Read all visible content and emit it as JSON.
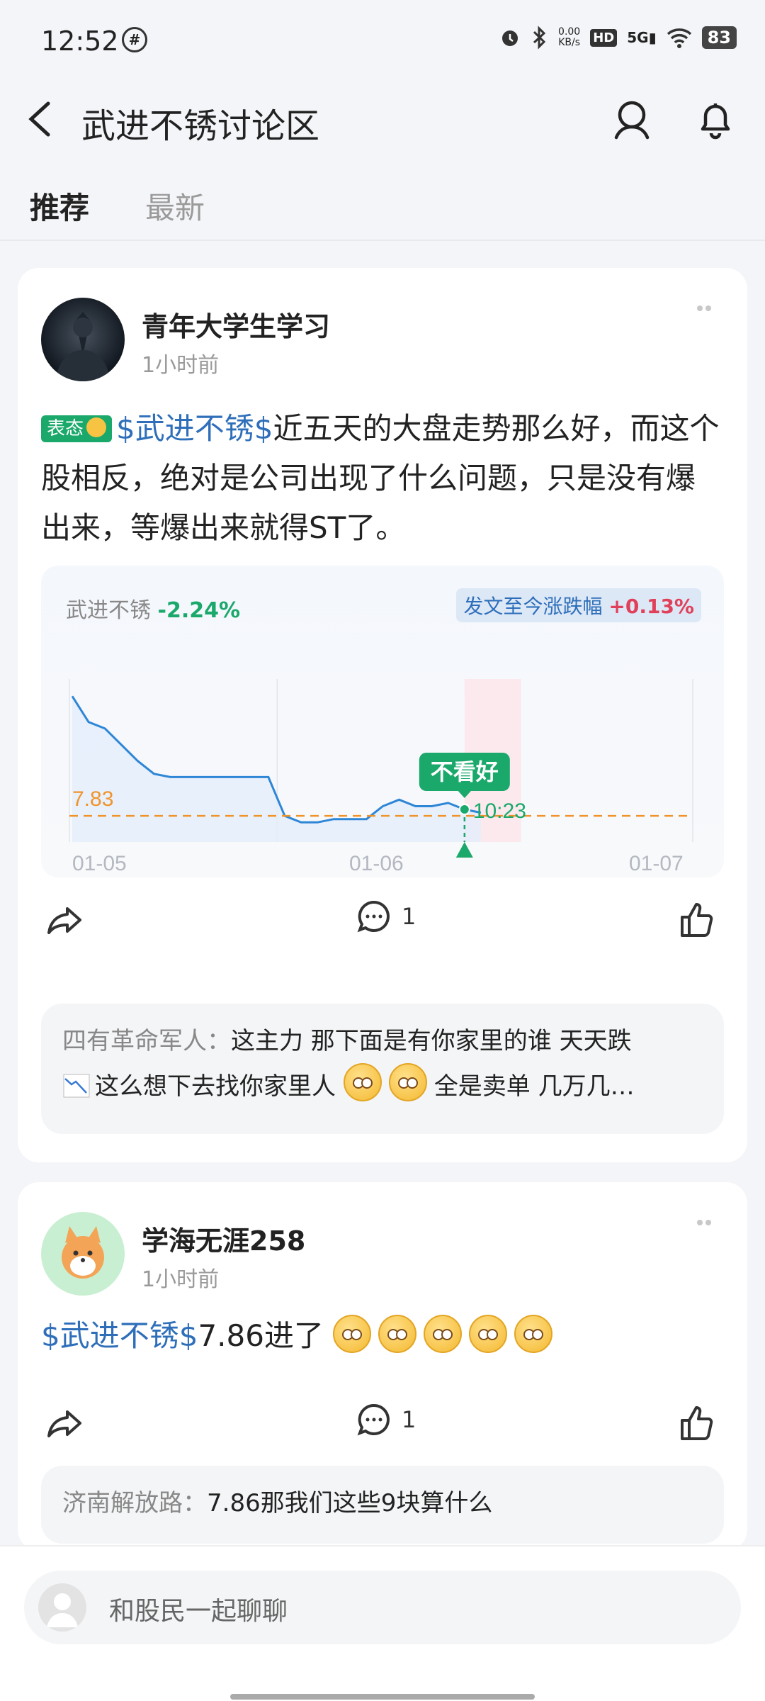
{
  "status_bar": {
    "time": "12:52",
    "network_speed_value": "0.00",
    "network_speed_unit": "KB/s",
    "hd_label": "HD",
    "signal_label": "5G",
    "battery": "83"
  },
  "header": {
    "title": "武进不锈讨论区"
  },
  "tabs": [
    {
      "label": "推荐",
      "active": true
    },
    {
      "label": "最新",
      "active": false
    }
  ],
  "posts": [
    {
      "author": "青年大学生学习",
      "time": "1小时前",
      "mood": "表态",
      "stock_tag": "$武进不锈$",
      "text_rest": "近五天的大盘走势那么好，而这个股相反，绝对是公司出现了什么问题，只是没有爆出来，等爆出来就得ST了。",
      "comment_count": "1",
      "comment_preview": {
        "author": "四有革命军人：",
        "text_part1": "这主力 那下面是有你家里的谁 天天跌",
        "text_part2": "这么想下去找你家里人",
        "text_part3": "全是卖单 几万几…"
      }
    },
    {
      "author": "学海无涯258",
      "time": "1小时前",
      "stock_tag": "$武进不锈$",
      "text_rest": "7.86进了",
      "comment_count": "1",
      "comment_preview": {
        "author": "济南解放路：",
        "text": "7.86那我们这些9块算什么"
      }
    }
  ],
  "chart_data": {
    "type": "line",
    "stock_name": "武进不锈",
    "change": "-2.24%",
    "since_post_label": "发文至今涨跌幅",
    "since_post_value": "+0.13%",
    "x_ticks": [
      "01-05",
      "01-06",
      "01-07"
    ],
    "reference_price_label": "7.83",
    "marker_label": "不看好",
    "marker_value_label": "10:23",
    "series": [
      {
        "values": [
          8.2,
          8.12,
          8.1,
          8.05,
          8.0,
          7.96,
          7.95,
          7.95,
          7.95,
          7.95,
          7.95,
          7.95,
          7.95,
          7.83,
          7.81,
          7.81,
          7.82,
          7.82,
          7.82,
          7.86,
          7.88,
          7.86,
          7.86,
          7.87,
          7.85,
          7.84
        ]
      }
    ],
    "colors": {
      "line": "#2e86d6",
      "reference": "#f0932b",
      "down": "#1aa86b",
      "up": "#e0405a"
    },
    "grid": true
  },
  "bottom_bar": {
    "placeholder": "和股民一起聊聊"
  }
}
